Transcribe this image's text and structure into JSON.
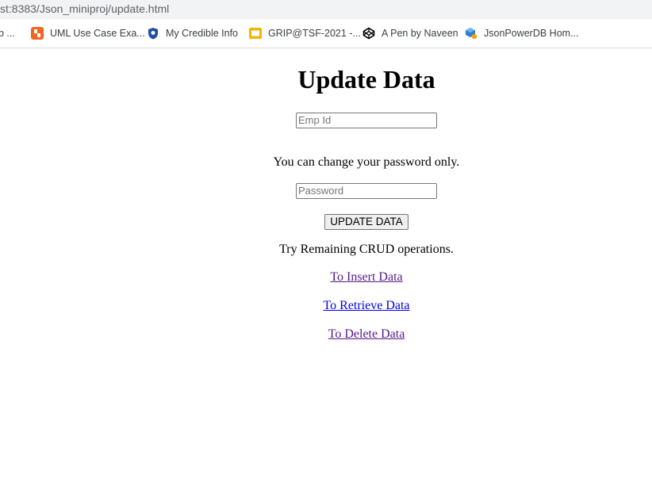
{
  "browser": {
    "url": "st:8383/Json_miniproj/update.html",
    "bookmarks": [
      {
        "label": "b ...",
        "icon": "truncated-bookmark-icon"
      },
      {
        "label": "UML Use Case Exa...",
        "icon": "lucidchart-icon",
        "color": "#f26522"
      },
      {
        "label": "My Credible Info",
        "icon": "shield-icon",
        "color": "#1f4fa3"
      },
      {
        "label": "GRIP@TSF-2021 -...",
        "icon": "slides-icon",
        "color": "#f4b400"
      },
      {
        "label": "A Pen by Naveen",
        "icon": "codepen-icon",
        "color": "#000000"
      },
      {
        "label": "JsonPowerDB Hom...",
        "icon": "jsonpowerdb-icon",
        "color": "#2d7fd3"
      }
    ]
  },
  "page": {
    "title": "Update Data",
    "emp_id": {
      "placeholder": "Emp Id",
      "value": ""
    },
    "note": "You can change your password only.",
    "password": {
      "placeholder": "Password",
      "value": ""
    },
    "update_button": "UPDATE DATA",
    "crud_text": "Try Remaining CRUD operations.",
    "links": {
      "insert": "To Insert Data",
      "retrieve": "To Retrieve Data",
      "delete": "To Delete Data"
    }
  }
}
